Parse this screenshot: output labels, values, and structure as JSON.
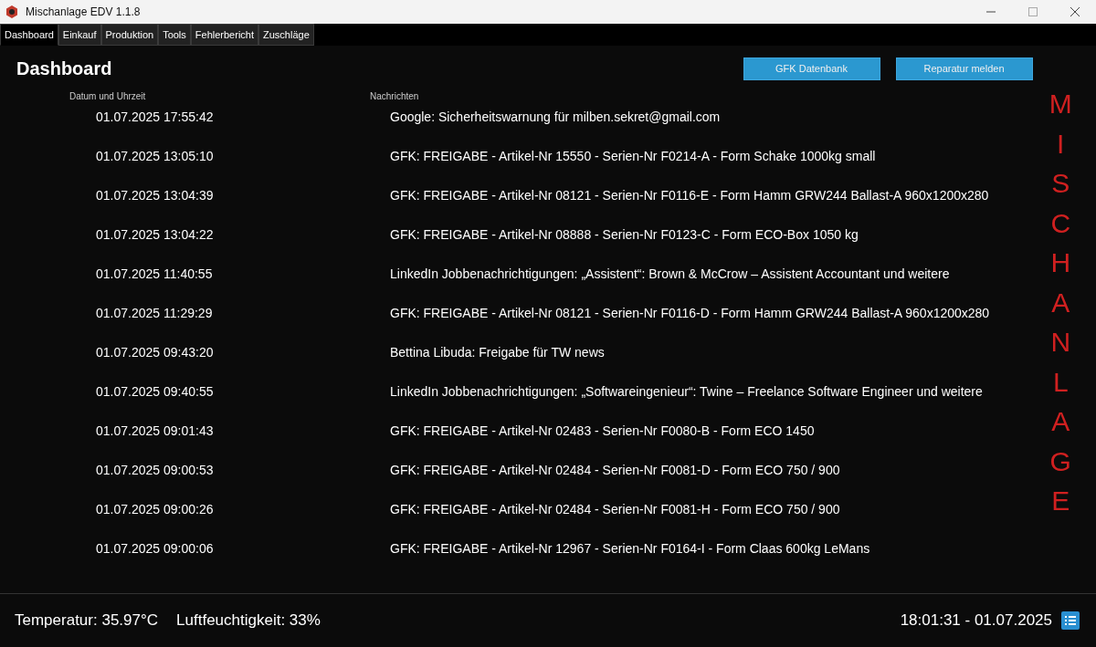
{
  "window": {
    "title": "Mischanlage EDV 1.1.8"
  },
  "tabs": [
    {
      "label": "Dashboard",
      "selected": true
    },
    {
      "label": "Einkauf",
      "selected": false
    },
    {
      "label": "Produktion",
      "selected": false
    },
    {
      "label": "Tools",
      "selected": false
    },
    {
      "label": "Fehlerbericht",
      "selected": false
    },
    {
      "label": "Zuschläge",
      "selected": false
    }
  ],
  "page_title": "Dashboard",
  "buttons": [
    "GFK Datenbank",
    "Reparatur melden"
  ],
  "table": {
    "columns": [
      "Datum und Uhrzeit",
      "Nachrichten"
    ],
    "rows": [
      [
        "01.07.2025 17:55:42",
        "Google: Sicherheitswarnung für milben.sekret@gmail.com"
      ],
      [
        "01.07.2025 13:05:10",
        "GFK: FREIGABE - Artikel-Nr 15550 - Serien-Nr F0214-A - Form Schake 1000kg small"
      ],
      [
        "01.07.2025 13:04:39",
        "GFK: FREIGABE - Artikel-Nr 08121 - Serien-Nr F0116-E - Form Hamm GRW244 Ballast-A 960x1200x280"
      ],
      [
        "01.07.2025 13:04:22",
        "GFK: FREIGABE - Artikel-Nr 08888 - Serien-Nr F0123-C - Form ECO-Box 1050 kg"
      ],
      [
        "01.07.2025 11:40:55",
        "LinkedIn Jobbenachrichtigungen: „Assistent“: Brown & McCrow – Assistent Accountant  und weitere"
      ],
      [
        "01.07.2025 11:29:29",
        "GFK: FREIGABE - Artikel-Nr 08121 - Serien-Nr F0116-D - Form Hamm GRW244 Ballast-A 960x1200x280"
      ],
      [
        "01.07.2025 09:43:20",
        "Bettina Libuda: Freigabe für TW news"
      ],
      [
        "01.07.2025 09:40:55",
        "LinkedIn Jobbenachrichtigungen: „Softwareingenieur“: Twine – Freelance Software Engineer und weitere"
      ],
      [
        "01.07.2025 09:01:43",
        "GFK: FREIGABE - Artikel-Nr 02483 - Serien-Nr F0080-B - Form ECO 1450"
      ],
      [
        "01.07.2025 09:00:53",
        "GFK: FREIGABE - Artikel-Nr 02484 - Serien-Nr F0081-D - Form ECO 750 / 900"
      ],
      [
        "01.07.2025 09:00:26",
        "GFK: FREIGABE - Artikel-Nr 02484 - Serien-Nr F0081-H - Form ECO 750 / 900"
      ],
      [
        "01.07.2025 09:00:06",
        "GFK: FREIGABE - Artikel-Nr 12967 - Serien-Nr F0164-I - Form Claas 600kg LeMans"
      ]
    ]
  },
  "side_label": "MISCHANLAGE",
  "status_bar": {
    "temperature": "Temperatur: 35.97°C",
    "humidity": "Luftfeuchtigkeit: 33%",
    "datetime": "18:01:31 - 01.07.2025"
  }
}
